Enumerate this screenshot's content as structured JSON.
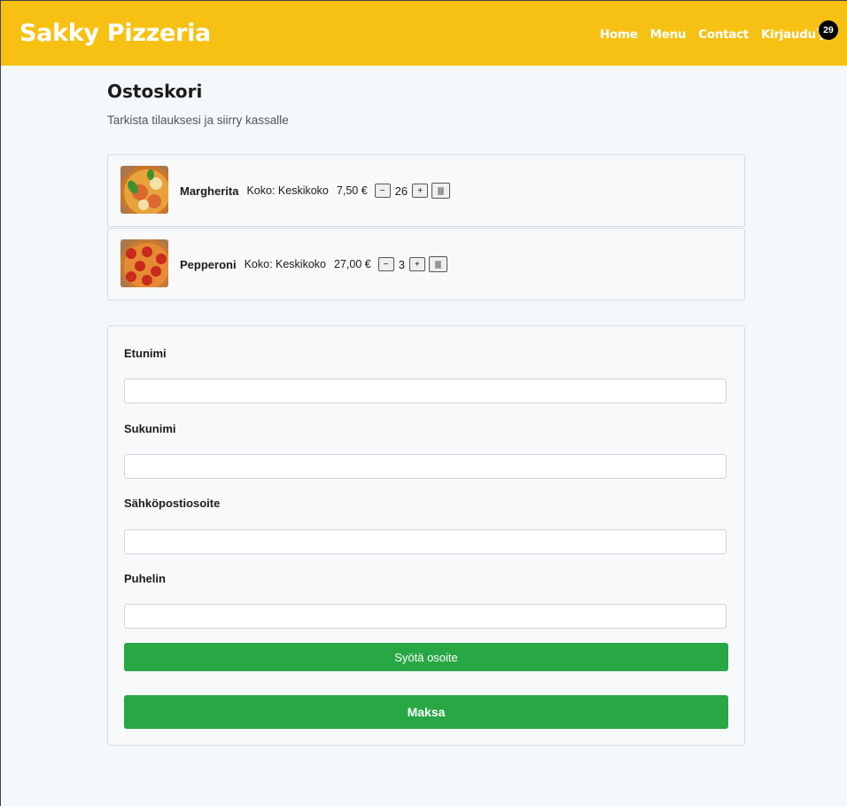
{
  "header": {
    "brand": "Sakky Pizzeria",
    "nav": [
      "Home",
      "Menu",
      "Contact",
      "Kirjaudu"
    ],
    "cart_count": "29",
    "accent": "#f7c114"
  },
  "page": {
    "title": "Ostoskori",
    "subtitle": "Tarkista tilauksesi ja siirry kassalle"
  },
  "cart": {
    "items": [
      {
        "name": "Margherita",
        "size": "Koko: Keskikoko",
        "price": "7,50 €",
        "qty": "26",
        "image": "margherita-pizza"
      },
      {
        "name": "Pepperoni",
        "size": "Koko: Keskikoko",
        "price": "27,00 €",
        "qty": "3",
        "image": "pepperoni-pizza"
      }
    ],
    "minus_label": "−",
    "plus_label": "+"
  },
  "form": {
    "first_name_label": "Etunimi",
    "last_name_label": "Sukunimi",
    "email_label": "Sähköpostiosoite",
    "phone_label": "Puhelin",
    "first_name_value": "",
    "last_name_value": "",
    "email_value": "",
    "phone_value": "",
    "address_button": "Syötä osoite",
    "pay_button": "Maksa",
    "button_color": "#28a745"
  }
}
